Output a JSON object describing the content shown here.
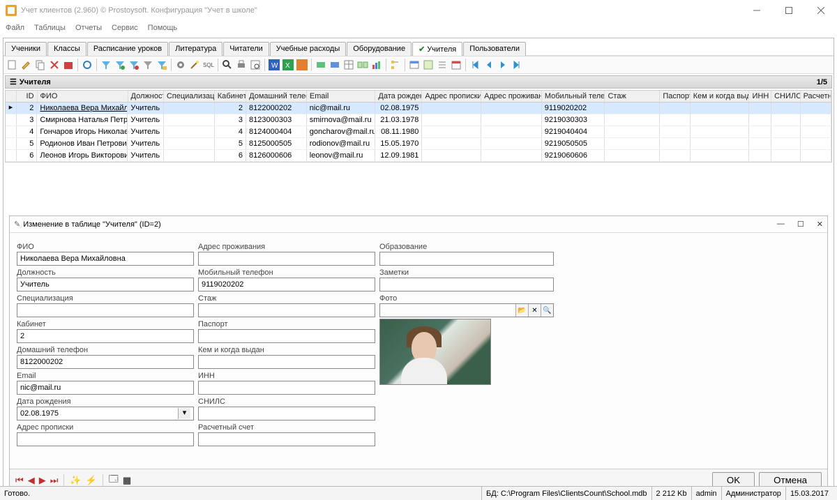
{
  "window": {
    "title": "Учет клиентов (2.960) © Prostoysoft. Конфигурация \"Учет в школе\""
  },
  "menu": [
    "Файл",
    "Таблицы",
    "Отчеты",
    "Сервис",
    "Помощь"
  ],
  "tabs": [
    {
      "label": "Ученики"
    },
    {
      "label": "Классы"
    },
    {
      "label": "Расписание уроков"
    },
    {
      "label": "Литература"
    },
    {
      "label": "Читатели"
    },
    {
      "label": "Учебные расходы"
    },
    {
      "label": "Оборудование"
    },
    {
      "label": "Учителя",
      "active": true
    },
    {
      "label": "Пользователи"
    }
  ],
  "panel": {
    "title": "Учителя",
    "counter": "1/5"
  },
  "grid": {
    "headers": [
      "ID",
      "ФИО",
      "Должность",
      "Специализация",
      "Кабинет",
      "Домашний телефон",
      "Email",
      "Дата рождения",
      "Адрес прописки",
      "Адрес проживания",
      "Мобильный телефон",
      "Стаж",
      "Паспорт",
      "Кем и когда выдан",
      "ИНН",
      "СНИЛС",
      "Расчетн"
    ],
    "rows": [
      {
        "id": "2",
        "fio": "Николаева Вера Михайловна",
        "dol": "Учитель",
        "spec": "",
        "kab": "2",
        "tel": "8122000202",
        "email": "nic@mail.ru",
        "dr": "02.08.1975",
        "mob": "9119020202",
        "selected": true
      },
      {
        "id": "3",
        "fio": "Смирнова Наталья Петровна",
        "dol": "Учитель",
        "spec": "",
        "kab": "3",
        "tel": "8123000303",
        "email": "smirnova@mail.ru",
        "dr": "21.03.1978",
        "mob": "9219030303"
      },
      {
        "id": "4",
        "fio": "Гончаров Игорь Николаевич",
        "dol": "Учитель",
        "spec": "",
        "kab": "4",
        "tel": "8124000404",
        "email": "goncharov@mail.ru",
        "dr": "08.11.1980",
        "mob": "9219040404"
      },
      {
        "id": "5",
        "fio": "Родионов Иван Петрович",
        "dol": "Учитель",
        "spec": "",
        "kab": "5",
        "tel": "8125000505",
        "email": "rodionov@mail.ru",
        "dr": "15.05.1970",
        "mob": "9219050505"
      },
      {
        "id": "6",
        "fio": "Леонов Игорь Викторович",
        "dol": "Учитель",
        "spec": "",
        "kab": "6",
        "tel": "8126000606",
        "email": "leonov@mail.ru",
        "dr": "12.09.1981",
        "mob": "9219060606"
      }
    ]
  },
  "edit": {
    "title": "Изменение в таблице \"Учителя\" (ID=2)",
    "labels": {
      "fio": "ФИО",
      "dol": "Должность",
      "spec": "Специализация",
      "kab": "Кабинет",
      "tel": "Домашний телефон",
      "email": "Email",
      "dr": "Дата рождения",
      "ap": "Адрес прописки",
      "apz": "Адрес проживания",
      "mob": "Мобильный телефон",
      "staz": "Стаж",
      "pasp": "Паспорт",
      "kem": "Кем и когда выдан",
      "inn": "ИНН",
      "snils": "СНИЛС",
      "rasch": "Расчетный счет",
      "obr": "Образование",
      "zam": "Заметки",
      "foto": "Фото"
    },
    "values": {
      "fio": "Николаева Вера Михайловна",
      "dol": "Учитель",
      "spec": "",
      "kab": "2",
      "tel": "8122000202",
      "email": "nic@mail.ru",
      "dr": "02.08.1975",
      "ap": "",
      "apz": "",
      "mob": "9119020202",
      "staz": "",
      "pasp": "",
      "kem": "",
      "inn": "",
      "snils": "",
      "rasch": "",
      "obr": "",
      "zam": ""
    },
    "buttons": {
      "ok": "OK",
      "cancel": "Отмена"
    }
  },
  "status": {
    "ready": "Готово.",
    "db_label": "БД:",
    "db_path": "C:\\Program Files\\ClientsCount\\School.mdb",
    "size": "2 212 Kb",
    "user": "admin",
    "role": "Администратор",
    "date": "15.03.2017"
  }
}
